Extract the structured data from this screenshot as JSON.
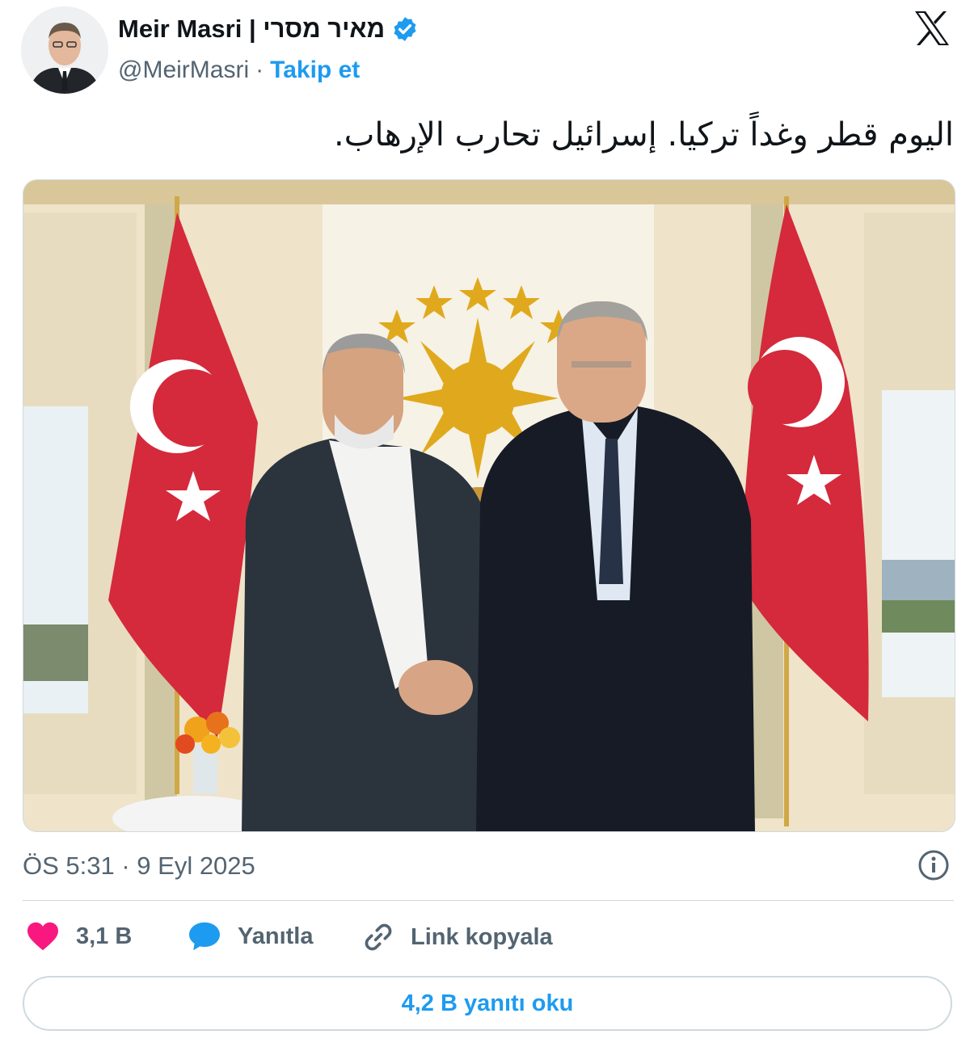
{
  "author": {
    "name": "Meir Masri | מאיר מסרי",
    "handle": "@MeirMasri",
    "separator": "·",
    "follow_label": "Takip et",
    "verified_badge_icon": "verified-badge-icon"
  },
  "platform_logo": "x-logo-icon",
  "tweet": {
    "text": "اليوم قطر وغداً تركيا. إسرائيل تحارب الإرهاب.",
    "image_description_icon": "photo-icon",
    "timestamp": "ÖS 5:31 · 9 Eyl 2025"
  },
  "actions": {
    "like_count": "3,1 B",
    "reply_label": "Yanıtla",
    "copy_link_label": "Link kopyala"
  },
  "read_replies_label": "4,2 B yanıtı oku",
  "colors": {
    "accent": "#1d9bf0",
    "like": "#f91880",
    "muted": "#536471",
    "flag_red": "#d42a3c"
  }
}
